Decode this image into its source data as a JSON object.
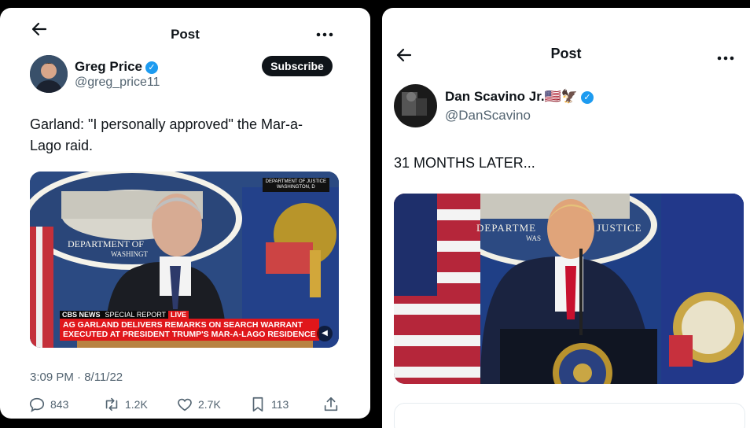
{
  "left_post": {
    "header_title": "Post",
    "author_name": "Greg Price",
    "author_handle": "@greg_price11",
    "subscribe_label": "Subscribe",
    "text": "Garland: \"I personally approved\" the Mar-a-Lago raid.",
    "media": {
      "seal_text": "DEPARTMENT OF",
      "seal_subtext": "WASHINGT",
      "corner_tag_line1": "DEPARTMENT OF JUSTICE",
      "corner_tag_line2": "WASHINGTON, D",
      "network": "CBS NEWS",
      "special_report": "SPECIAL REPORT",
      "live": "LIVE",
      "headline_line1": "AG GARLAND DELIVERS REMARKS ON SEARCH WARRANT",
      "headline_line2": "EXECUTED AT PRESIDENT TRUMP'S MAR-A-LAGO RESIDENCE"
    },
    "timestamp": "3:09 PM · 8/11/22",
    "stats": {
      "replies": "843",
      "reposts": "1.2K",
      "likes": "2.7K",
      "bookmarks": "113"
    }
  },
  "right_post": {
    "header_title": "Post",
    "author_name": "Dan Scavino Jr.🇺🇸🦅",
    "author_handle": "@DanScavino",
    "text": "31 MONTHS LATER...",
    "media": {
      "seal_text": "DEPARTME",
      "seal_text2": "JUSTICE",
      "seal_subtext": "WAS"
    }
  },
  "colors": {
    "accent": "#1d9bf0",
    "text": "#0f1419",
    "muted": "#536471",
    "live_red": "#e0171b"
  }
}
